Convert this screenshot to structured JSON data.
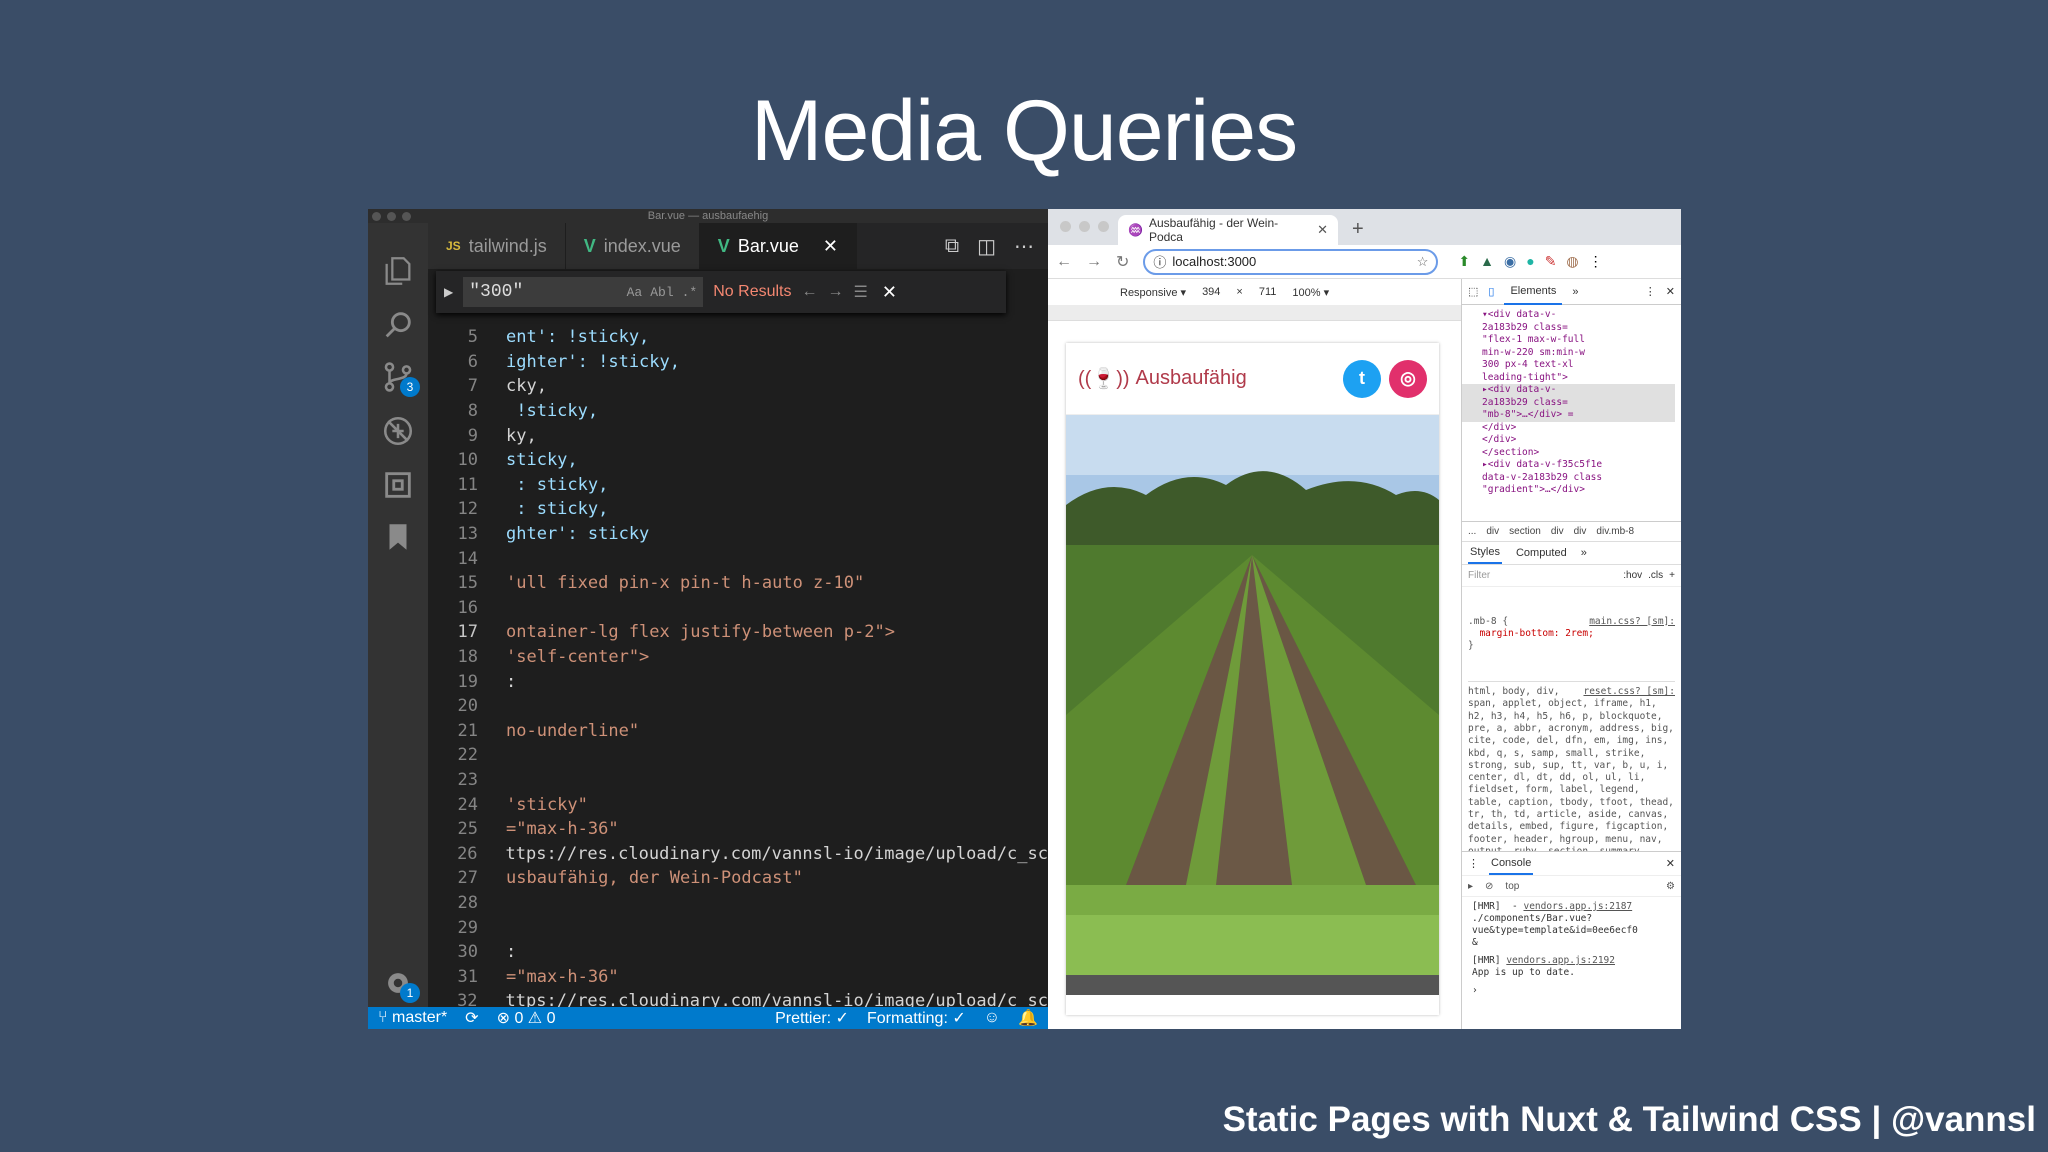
{
  "slide": {
    "title": "Media Queries",
    "footer": "Static Pages with Nuxt & Tailwind CSS | @vannsl"
  },
  "vscode": {
    "window_title": "Bar.vue — ausbaufaehig",
    "tabs": [
      {
        "label": "tailwind.js",
        "icon": "JS"
      },
      {
        "label": "index.vue",
        "icon": "vue-icon"
      },
      {
        "label": "Bar.vue",
        "icon": "vue-icon",
        "active": true
      }
    ],
    "find": {
      "query": "\"300\"",
      "options": [
        "Aa",
        "Abl",
        ".*"
      ],
      "result": "No Results"
    },
    "activity_badges": {
      "source_control": "3",
      "settings": "1"
    },
    "code_lines": [
      {
        "n": "5",
        "text": "ent': !sticky,"
      },
      {
        "n": "6",
        "text": "ighter': !sticky,"
      },
      {
        "n": "7",
        "text": "cky,"
      },
      {
        "n": "8",
        "text": " !sticky,"
      },
      {
        "n": "9",
        "text": "ky,"
      },
      {
        "n": "10",
        "text": "sticky,"
      },
      {
        "n": "11",
        "text": " : sticky,"
      },
      {
        "n": "12",
        "text": " : sticky,"
      },
      {
        "n": "13",
        "text": "ghter': sticky"
      },
      {
        "n": "14",
        "text": ""
      },
      {
        "n": "15",
        "text": "'ull fixed pin-x pin-t h-auto z-10\""
      },
      {
        "n": "16",
        "text": ""
      },
      {
        "n": "17",
        "text": "ontainer-lg flex justify-between p-2\">"
      },
      {
        "n": "18",
        "text": "'self-center\">"
      },
      {
        "n": "19",
        "text": ":"
      },
      {
        "n": "20",
        "text": ""
      },
      {
        "n": "21",
        "text": "no-underline\""
      },
      {
        "n": "22",
        "text": ""
      },
      {
        "n": "23",
        "text": ""
      },
      {
        "n": "24",
        "text": "'sticky\""
      },
      {
        "n": "25",
        "text": "=\"max-h-36\""
      },
      {
        "n": "26",
        "text": "ttps://res.cloudinary.com/vannsl-io/image/upload/c_sc"
      },
      {
        "n": "27",
        "text": "usbaufähig, der Wein-Podcast\""
      },
      {
        "n": "28",
        "text": ""
      },
      {
        "n": "29",
        "text": ""
      },
      {
        "n": "30",
        "text": ":"
      },
      {
        "n": "31",
        "text": "=\"max-h-36\""
      },
      {
        "n": "32",
        "text": "ttps://res.cloudinary.com/vannsl-io/image/upload/c_sc"
      }
    ],
    "status": {
      "branch": "master*",
      "errors": "0",
      "warnings": "0",
      "prettier": "Prettier: ✓",
      "formatting": "Formatting: ✓"
    }
  },
  "browser": {
    "tab_title": "Ausbaufähig - der Wein-Podca",
    "url": "localhost:3000",
    "responsive": {
      "mode": "Responsive ▾",
      "width": "394",
      "height": "711",
      "zoom": "100% ▾"
    },
    "site": {
      "logo_text": "Ausbaufähig"
    }
  },
  "devtools": {
    "tabs": [
      "Elements",
      "»"
    ],
    "dom_lines": [
      "▾<div data-v-",
      "2a183b29 class=",
      "\"flex-1 max-w-full",
      "min-w-220 sm:min-w",
      "300 px-4 text-xl",
      "leading-tight\">",
      "▸<div data-v-",
      "2a183b29 class=",
      "\"mb-8\">…</div> =",
      "</div>",
      "</div>",
      "</section>",
      "▸<div data-v-f35c5f1e",
      "data-v-2a183b29 class",
      "\"gradient\">…</div>"
    ],
    "breadcrumbs": [
      "...",
      "div",
      "section",
      "div",
      "div",
      "div.mb-8"
    ],
    "sub_tabs": [
      "Styles",
      "Computed",
      "»"
    ],
    "filter": {
      "placeholder": "Filter",
      "hov": ":hov",
      "cls": ".cls",
      "plus": "+"
    },
    "rule1": {
      "selector": ".mb-8 {",
      "source": "main.css? [sm]:",
      "prop": "margin-bottom: 2rem;",
      "close": "}"
    },
    "rule2": {
      "source": "reset.css? [sm]:",
      "selectors": "html, body, div, span, applet, object, iframe, h1, h2, h3, h4, h5, h6, p, blockquote, pre, a, abbr, acronym, address, big, cite, code, del, dfn, em, img, ins, kbd, q, s, samp, small, strike, strong, sub, sup, tt, var, b, u, i, center, dl, dt, dd, ol, ul, li, fieldset, form, label, legend, table, caption, tbody, tfoot, thead, tr, th, td, article, aside, canvas, details, embed, figure, figcaption, footer, header, hgroup, menu, nav, output, ruby, section, summary, time, mark, audio, video {"
    },
    "console": {
      "label": "Console",
      "context": "top",
      "lines": [
        {
          "prefix": "[HMR]  - ",
          "link": "vendors.app.js:2187",
          "text": "./components/Bar.vue?\nvue&type=template&id=0ee6ecf0\n&"
        },
        {
          "prefix": "[HMR] ",
          "link": "vendors.app.js:2192",
          "text": "App is up to date."
        }
      ]
    }
  }
}
